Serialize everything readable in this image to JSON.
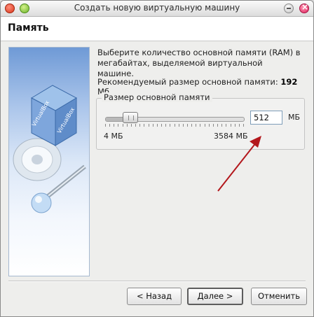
{
  "window": {
    "title": "Создать новую виртуальную машину"
  },
  "header": {
    "title": "Память"
  },
  "content": {
    "description": "Выберите количество основной памяти (RAM) в мегабайтах, выделяемой виртуальной машине.",
    "recommended_prefix": "Рекомендуемый размер основной памяти:",
    "recommended_value": "192",
    "recommended_unit": "Мб."
  },
  "memory": {
    "group_label": "Размер основной памяти",
    "min_label": "4 МБ",
    "max_label": "3584 МБ",
    "value": "512",
    "unit": "МБ",
    "slider_min": 4,
    "slider_max": 3584,
    "slider_value": 512
  },
  "buttons": {
    "back": "< Назад",
    "next": "Далее >",
    "cancel": "Отменить"
  },
  "colors": {
    "annotation_arrow": "#b3171c",
    "side_panel_top": "#6f9ad6"
  },
  "icons": {
    "side_image": "virtualbox-cube-logo",
    "annotation": "red-arrow"
  }
}
